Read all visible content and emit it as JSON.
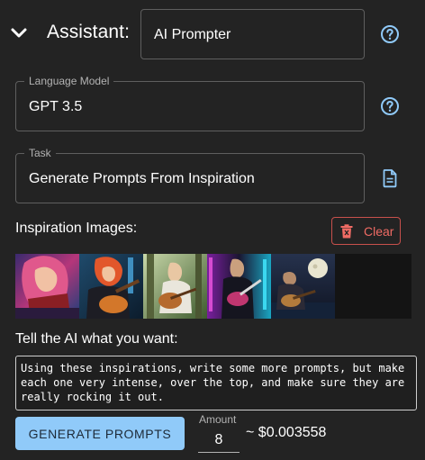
{
  "assistant": {
    "label": "Assistant:",
    "name_value": "AI Prompter"
  },
  "language_model": {
    "label": "Language Model",
    "value": "GPT 3.5"
  },
  "task": {
    "label": "Task",
    "value": "Generate Prompts From Inspiration"
  },
  "inspiration": {
    "label": "Inspiration Images:",
    "clear_label": "Clear",
    "image_count": 5
  },
  "prompt": {
    "label": "Tell the AI what you want:",
    "value": "Using these inspirations, write some more prompts, but make each one very intense, over the top, and make sure they are really rocking it out."
  },
  "actions": {
    "generate_label": "GENERATE PROMPTS",
    "amount_label": "Amount",
    "amount_value": "8",
    "cost": "~ $0.003558"
  },
  "colors": {
    "background": "#232323",
    "accent": "#90caf9",
    "danger": "#f06b64",
    "help_icon": "#90caf9"
  },
  "icons": {
    "collapse": "chevron-down-icon",
    "help": "help-circle-icon",
    "document": "document-icon",
    "delete": "trash-icon"
  }
}
